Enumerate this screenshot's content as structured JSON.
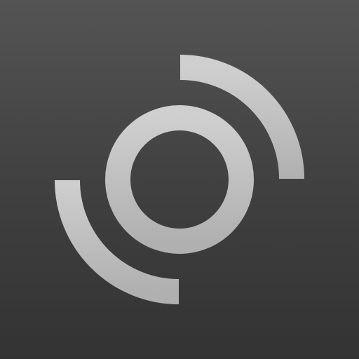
{
  "icon": {
    "name": "orbit-logo",
    "glyph_color": "#b0b0b0",
    "glyph_highlight": "#cfcfcf",
    "background_top": "#545454",
    "background_bottom": "#333333"
  }
}
